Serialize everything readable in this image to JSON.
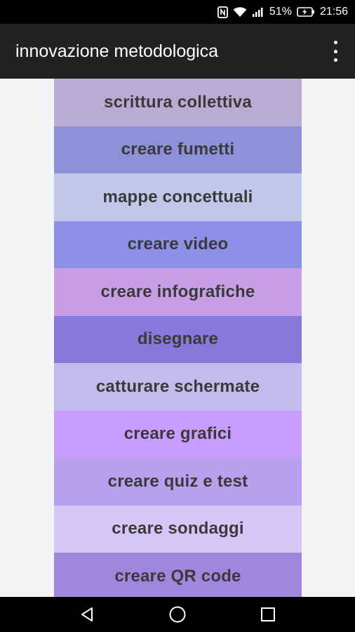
{
  "status_bar": {
    "battery": "51%",
    "time": "21:56",
    "icons": [
      "nfc-icon",
      "wifi-icon",
      "signal-icon",
      "battery-icon"
    ]
  },
  "app_bar": {
    "title": "innovazione metodologica",
    "overflow_icon": "more-vert-icon"
  },
  "list": {
    "items": [
      {
        "label": "scrittura collettiva",
        "color": "#b8abd4"
      },
      {
        "label": "creare fumetti",
        "color": "#8e91da"
      },
      {
        "label": "mappe concettuali",
        "color": "#c3c6eb"
      },
      {
        "label": "creare video",
        "color": "#8e90e8"
      },
      {
        "label": "creare infografiche",
        "color": "#c89fe7"
      },
      {
        "label": "disegnare",
        "color": "#8779d9"
      },
      {
        "label": "catturare schermate",
        "color": "#c1bcec"
      },
      {
        "label": "creare grafici",
        "color": "#c89dfd"
      },
      {
        "label": "creare quiz e test",
        "color": "#b8a0ef"
      },
      {
        "label": "creare sondaggi",
        "color": "#d6c8f6"
      },
      {
        "label": "creare QR code",
        "color": "#a086dd"
      }
    ]
  },
  "nav_bar": {
    "icons": [
      "back-icon",
      "home-icon",
      "recents-icon"
    ]
  }
}
